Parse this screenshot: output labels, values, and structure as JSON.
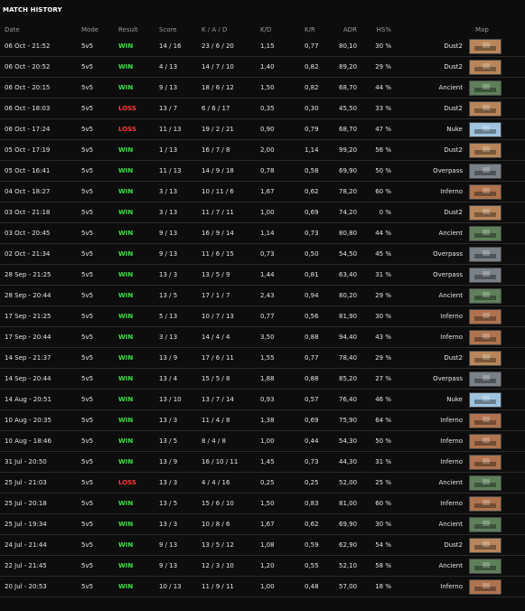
{
  "page": {
    "title": "MATCH HISTORY"
  },
  "columns": {
    "date": "Date",
    "mode": "Mode",
    "result": "Result",
    "score": "Score",
    "kad": "K / A / D",
    "kd": "K/D",
    "kr": "K/R",
    "adr": "ADR",
    "hs": "HS%",
    "map": "Map"
  },
  "colors": {
    "win": "#3fe04a",
    "loss": "#ff3b3b"
  },
  "map_thumbs": {
    "Dust2": "#b8865a",
    "Ancient": "#5e7f5a",
    "Nuke": "#9fc3df",
    "Overpass": "#7a8188",
    "Inferno": "#b0734f"
  },
  "matches": [
    {
      "date": "06 Oct - 21:52",
      "mode": "5v5",
      "result": "WIN",
      "score": "14 / 16",
      "kad": "23 / 6 / 20",
      "kd": "1,15",
      "kr": "0,77",
      "adr": "80,10",
      "hs": "30 %",
      "map": "Dust2"
    },
    {
      "date": "06 Oct - 20:52",
      "mode": "5v5",
      "result": "WIN",
      "score": "4 / 13",
      "kad": "14 / 7 / 10",
      "kd": "1,40",
      "kr": "0,82",
      "adr": "89,20",
      "hs": "29 %",
      "map": "Dust2"
    },
    {
      "date": "06 Oct - 20:15",
      "mode": "5v5",
      "result": "WIN",
      "score": "9 / 13",
      "kad": "18 / 6 / 12",
      "kd": "1,50",
      "kr": "0,82",
      "adr": "68,70",
      "hs": "44 %",
      "map": "Ancient"
    },
    {
      "date": "06 Oct - 18:03",
      "mode": "5v5",
      "result": "LOSS",
      "score": "13 / 7",
      "kad": "6 / 6 / 17",
      "kd": "0,35",
      "kr": "0,30",
      "adr": "45,50",
      "hs": "33 %",
      "map": "Dust2"
    },
    {
      "date": "06 Oct - 17:24",
      "mode": "5v5",
      "result": "LOSS",
      "score": "11 / 13",
      "kad": "19 / 2 / 21",
      "kd": "0,90",
      "kr": "0,79",
      "adr": "68,70",
      "hs": "47 %",
      "map": "Nuke"
    },
    {
      "date": "05 Oct - 17:19",
      "mode": "5v5",
      "result": "WIN",
      "score": "1 / 13",
      "kad": "16 / 7 / 8",
      "kd": "2,00",
      "kr": "1,14",
      "adr": "99,20",
      "hs": "56 %",
      "map": "Dust2"
    },
    {
      "date": "05 Oct - 16:41",
      "mode": "5v5",
      "result": "WIN",
      "score": "11 / 13",
      "kad": "14 / 9 / 18",
      "kd": "0,78",
      "kr": "0,58",
      "adr": "69,90",
      "hs": "50 %",
      "map": "Overpass"
    },
    {
      "date": "04 Oct - 18:27",
      "mode": "5v5",
      "result": "WIN",
      "score": "3 / 13",
      "kad": "10 / 11 / 6",
      "kd": "1,67",
      "kr": "0,62",
      "adr": "78,20",
      "hs": "60 %",
      "map": "Inferno"
    },
    {
      "date": "03 Oct - 21:18",
      "mode": "5v5",
      "result": "WIN",
      "score": "3 / 13",
      "kad": "11 / 7 / 11",
      "kd": "1,00",
      "kr": "0,69",
      "adr": "74,20",
      "hs": "0 %",
      "map": "Dust2"
    },
    {
      "date": "03 Oct - 20:45",
      "mode": "5v5",
      "result": "WIN",
      "score": "9 / 13",
      "kad": "16 / 9 / 14",
      "kd": "1,14",
      "kr": "0,73",
      "adr": "80,80",
      "hs": "44 %",
      "map": "Ancient"
    },
    {
      "date": "02 Oct - 21:34",
      "mode": "5v5",
      "result": "WIN",
      "score": "9 / 13",
      "kad": "11 / 6 / 15",
      "kd": "0,73",
      "kr": "0,50",
      "adr": "54,50",
      "hs": "45 %",
      "map": "Overpass"
    },
    {
      "date": "28 Sep - 21:25",
      "mode": "5v5",
      "result": "WIN",
      "score": "13 / 3",
      "kad": "13 / 5 / 9",
      "kd": "1,44",
      "kr": "0,81",
      "adr": "63,40",
      "hs": "31 %",
      "map": "Overpass"
    },
    {
      "date": "28 Sep - 20:44",
      "mode": "5v5",
      "result": "WIN",
      "score": "13 / 5",
      "kad": "17 / 1 / 7",
      "kd": "2,43",
      "kr": "0,94",
      "adr": "80,20",
      "hs": "29 %",
      "map": "Ancient"
    },
    {
      "date": "17 Sep - 21:25",
      "mode": "5v5",
      "result": "WIN",
      "score": "5 / 13",
      "kad": "10 / 7 / 13",
      "kd": "0,77",
      "kr": "0,56",
      "adr": "81,90",
      "hs": "30 %",
      "map": "Inferno"
    },
    {
      "date": "17 Sep - 20:44",
      "mode": "5v5",
      "result": "WIN",
      "score": "3 / 13",
      "kad": "14 / 4 / 4",
      "kd": "3,50",
      "kr": "0,88",
      "adr": "94,40",
      "hs": "43 %",
      "map": "Inferno"
    },
    {
      "date": "14 Sep - 21:37",
      "mode": "5v5",
      "result": "WIN",
      "score": "13 / 9",
      "kad": "17 / 6 / 11",
      "kd": "1,55",
      "kr": "0,77",
      "adr": "78,40",
      "hs": "29 %",
      "map": "Dust2"
    },
    {
      "date": "14 Sep - 20:44",
      "mode": "5v5",
      "result": "WIN",
      "score": "13 / 4",
      "kad": "15 / 5 / 8",
      "kd": "1,88",
      "kr": "0,88",
      "adr": "85,20",
      "hs": "27 %",
      "map": "Overpass"
    },
    {
      "date": "14 Aug - 20:51",
      "mode": "5v5",
      "result": "WIN",
      "score": "13 / 10",
      "kad": "13 / 7 / 14",
      "kd": "0,93",
      "kr": "0,57",
      "adr": "76,40",
      "hs": "46 %",
      "map": "Nuke"
    },
    {
      "date": "10 Aug - 20:35",
      "mode": "5v5",
      "result": "WIN",
      "score": "13 / 3",
      "kad": "11 / 4 / 8",
      "kd": "1,38",
      "kr": "0,69",
      "adr": "75,90",
      "hs": "64 %",
      "map": "Inferno"
    },
    {
      "date": "10 Aug - 18:46",
      "mode": "5v5",
      "result": "WIN",
      "score": "13 / 5",
      "kad": "8 / 4 / 8",
      "kd": "1,00",
      "kr": "0,44",
      "adr": "54,30",
      "hs": "50 %",
      "map": "Inferno"
    },
    {
      "date": "31 Jul - 20:50",
      "mode": "5v5",
      "result": "WIN",
      "score": "13 / 9",
      "kad": "16 / 10 / 11",
      "kd": "1,45",
      "kr": "0,73",
      "adr": "44,30",
      "hs": "31 %",
      "map": "Inferno"
    },
    {
      "date": "25 Jul - 21:03",
      "mode": "5v5",
      "result": "LOSS",
      "score": "13 / 3",
      "kad": "4 / 4 / 16",
      "kd": "0,25",
      "kr": "0,25",
      "adr": "52,00",
      "hs": "25 %",
      "map": "Ancient"
    },
    {
      "date": "25 Jul - 20:18",
      "mode": "5v5",
      "result": "WIN",
      "score": "13 / 5",
      "kad": "15 / 6 / 10",
      "kd": "1,50",
      "kr": "0,83",
      "adr": "81,00",
      "hs": "60 %",
      "map": "Inferno"
    },
    {
      "date": "25 Jul - 19:34",
      "mode": "5v5",
      "result": "WIN",
      "score": "13 / 3",
      "kad": "10 / 8 / 6",
      "kd": "1,67",
      "kr": "0,62",
      "adr": "69,90",
      "hs": "30 %",
      "map": "Ancient"
    },
    {
      "date": "24 Jul - 21:44",
      "mode": "5v5",
      "result": "WIN",
      "score": "9 / 13",
      "kad": "13 / 5 / 12",
      "kd": "1,08",
      "kr": "0,59",
      "adr": "62,90",
      "hs": "54 %",
      "map": "Dust2"
    },
    {
      "date": "22 Jul - 21:45",
      "mode": "5v5",
      "result": "WIN",
      "score": "9 / 13",
      "kad": "12 / 3 / 10",
      "kd": "1,20",
      "kr": "0,55",
      "adr": "52,10",
      "hs": "58 %",
      "map": "Ancient"
    },
    {
      "date": "20 Jul - 20:53",
      "mode": "5v5",
      "result": "WIN",
      "score": "10 / 13",
      "kad": "11 / 9 / 11",
      "kd": "1,00",
      "kr": "0,48",
      "adr": "57,00",
      "hs": "18 %",
      "map": "Inferno"
    }
  ]
}
